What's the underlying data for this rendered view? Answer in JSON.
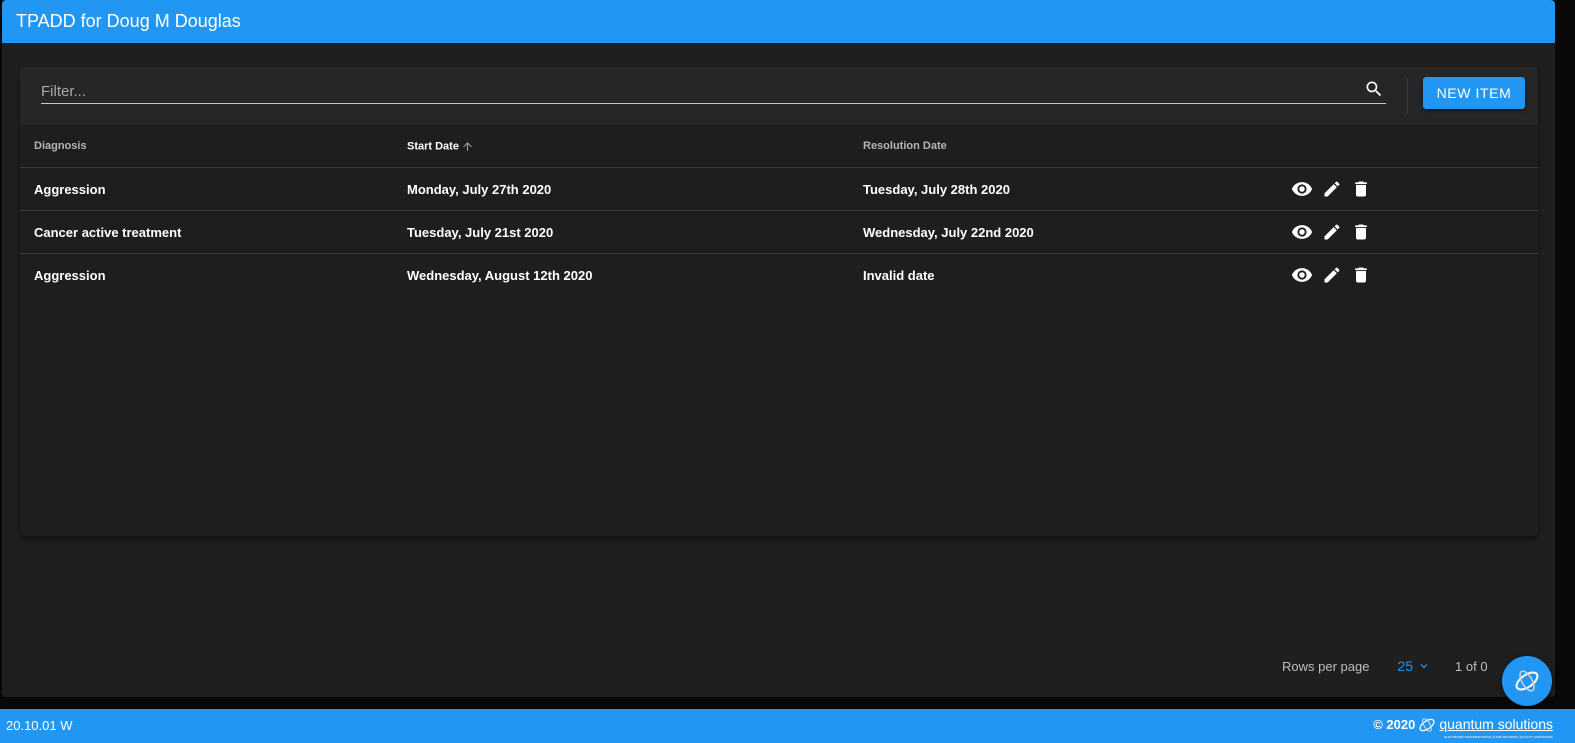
{
  "header": {
    "title": "TPADD for Doug M Douglas"
  },
  "toolbar": {
    "filter_placeholder": "Filter...",
    "filter_value": "",
    "search_icon": "search-icon",
    "new_item_label": "NEW ITEM"
  },
  "table": {
    "columns": [
      {
        "label": "Diagnosis",
        "sorted": false
      },
      {
        "label": "Start Date",
        "sorted": true,
        "sort_direction": "ascending"
      },
      {
        "label": "Resolution Date",
        "sorted": false
      },
      {
        "label": "",
        "sorted": false
      }
    ],
    "rows": [
      {
        "diagnosis": "Aggression",
        "start_date": "Monday, July 27th 2020",
        "resolution_date": "Tuesday, July 28th 2020"
      },
      {
        "diagnosis": "Cancer active treatment",
        "start_date": "Tuesday, July 21st 2020",
        "resolution_date": "Wednesday, July 22nd 2020"
      },
      {
        "diagnosis": "Aggression",
        "start_date": "Wednesday, August 12th 2020",
        "resolution_date": "Invalid date"
      }
    ],
    "row_actions": [
      "view-icon",
      "edit-icon",
      "delete-icon"
    ]
  },
  "pagination": {
    "rows_per_page_label": "Rows per page",
    "rows_per_page_value": "25",
    "page_info": "1 of 0"
  },
  "footer": {
    "version": "20.10.01 W",
    "copyright": "© 2020",
    "brand": "quantum solutions",
    "brand_tagline": "ELECTRONIC DOCUMENTATION | CARE RECORDS | QUALITY ASSURANCE"
  },
  "colors": {
    "accent": "#2196f3",
    "background": "#1f1f1f",
    "card": "#1e1e1e",
    "toolbar": "#262626"
  }
}
